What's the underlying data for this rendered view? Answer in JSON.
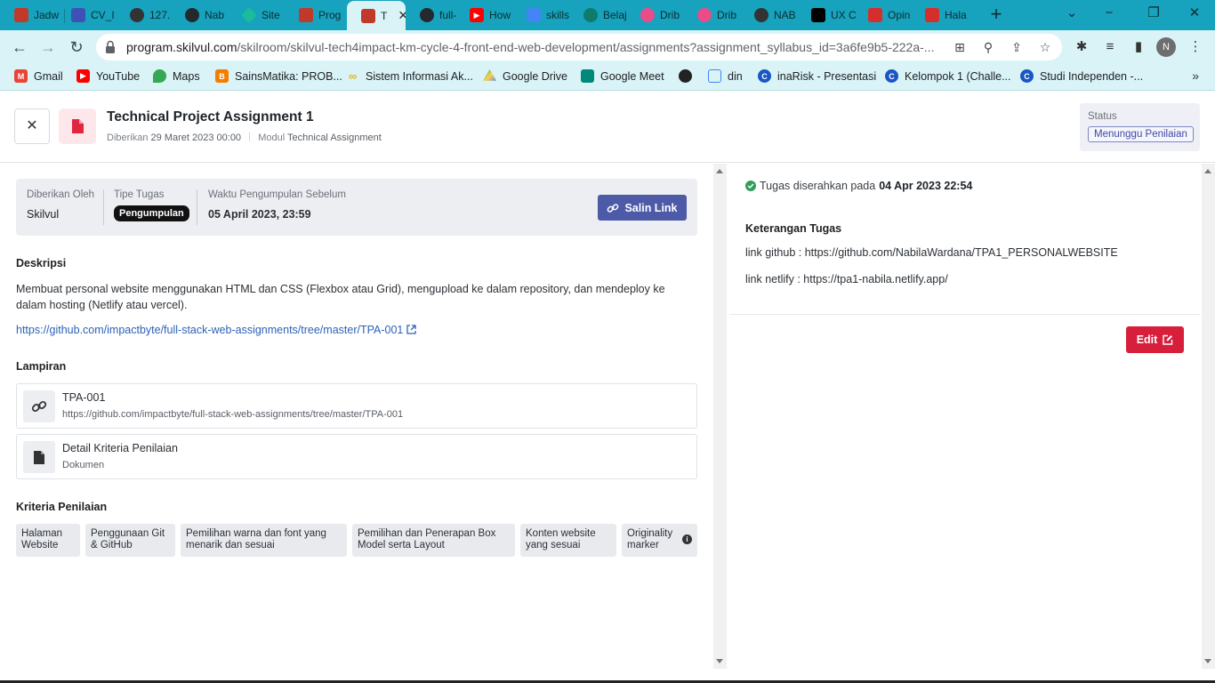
{
  "browser": {
    "tabs": [
      {
        "label": "Jadw",
        "color": "#c0392b"
      },
      {
        "label": "CV_I",
        "color": "#3f51b5"
      },
      {
        "label": "127.",
        "color": "#333333"
      },
      {
        "label": "Nab",
        "color": "#24292e"
      },
      {
        "label": "Site",
        "color": "#1abc9c"
      },
      {
        "label": "Prog",
        "color": "#c0392b"
      },
      {
        "label": "T",
        "color": "#c0392b",
        "active": true
      },
      {
        "label": "full-",
        "color": "#24292e"
      },
      {
        "label": "How",
        "color": "#ff0000"
      },
      {
        "label": "skills",
        "color": "#4285f4"
      },
      {
        "label": "Belaj",
        "color": "#0f7b6c"
      },
      {
        "label": "Drib",
        "color": "#ea4c89"
      },
      {
        "label": "Drib",
        "color": "#ea4c89"
      },
      {
        "label": "NAB",
        "color": "#333333"
      },
      {
        "label": "UX C",
        "color": "#000000"
      },
      {
        "label": "Opin",
        "color": "#d62d2d"
      },
      {
        "label": "Hala",
        "color": "#d62d2d"
      }
    ],
    "url_host": "program.skilvul.com",
    "url_path": "/skilroom/skilvul-tech4impact-km-cycle-4-front-end-web-development/assignments?assignment_syllabus_id=3a6fe9b5-222a-...",
    "profile_initial": "N",
    "bookmarks": [
      {
        "label": "Gmail",
        "color": "#ea4335"
      },
      {
        "label": "YouTube",
        "color": "#ff0000"
      },
      {
        "label": "Maps",
        "color": "#34a853"
      },
      {
        "label": "SainsMatika: PROB...",
        "color": "#f57c00"
      },
      {
        "label": "Sistem Informasi Ak...",
        "color": "#f4b400"
      },
      {
        "label": "Google Drive",
        "color": "#1fa463"
      },
      {
        "label": "Google Meet",
        "color": "#00897b"
      },
      {
        "label": "",
        "color": "#222222"
      },
      {
        "label": "din",
        "color": "#4285f4"
      },
      {
        "label": "inaRisk - Presentasi",
        "color": "#1a56c4"
      },
      {
        "label": "Kelompok 1 (Challe...",
        "color": "#1a56c4"
      },
      {
        "label": "Studi Independen -...",
        "color": "#1a56c4"
      }
    ]
  },
  "header": {
    "title": "Technical Project Assignment 1",
    "given_label": "Diberikan",
    "given_date": "29 Maret 2023 00:00",
    "module_label": "Modul",
    "module_value": "Technical Assignment",
    "status_label": "Status",
    "status_value": "Menunggu Penilaian"
  },
  "info": {
    "given_by_label": "Diberikan Oleh",
    "given_by_value": "Skilvul",
    "type_label": "Tipe Tugas",
    "type_value": "Pengumpulan",
    "deadline_label": "Waktu Pengumpulan Sebelum",
    "deadline_value": "05 April 2023, 23:59",
    "copy_link_label": "Salin Link"
  },
  "description": {
    "title": "Deskripsi",
    "text": "Membuat personal website menggunakan HTML dan CSS (Flexbox atau Grid), mengupload ke dalam repository, dan mendeploy ke dalam hosting (Netlify atau vercel).",
    "link": "https://github.com/impactbyte/full-stack-web-assignments/tree/master/TPA-001"
  },
  "attachments": {
    "title": "Lampiran",
    "items": [
      {
        "title": "TPA-001",
        "subtitle": "https://github.com/impactbyte/full-stack-web-assignments/tree/master/TPA-001"
      },
      {
        "title": "Detail Kriteria Penilaian",
        "subtitle": "Dokumen"
      }
    ]
  },
  "criteria": {
    "title": "Kriteria Penilaian",
    "items": [
      "Halaman Website",
      "Penggunaan Git & GitHub",
      "Pemilihan warna dan font yang menarik dan sesuai",
      "Pemilihan dan Penerapan Box Model serta Layout",
      "Konten website yang sesuai",
      "Originality marker"
    ]
  },
  "submission": {
    "submitted_prefix": "Tugas diserahkan pada",
    "submitted_date": "04 Apr 2023 22:54",
    "notes_title": "Keterangan Tugas",
    "line1": "link github : https://github.com/NabilaWardana/TPA1_PERSONALWEBSITE",
    "line2": "link netlify : https://tpa1-nabila.netlify.app/",
    "edit_label": "Edit"
  }
}
